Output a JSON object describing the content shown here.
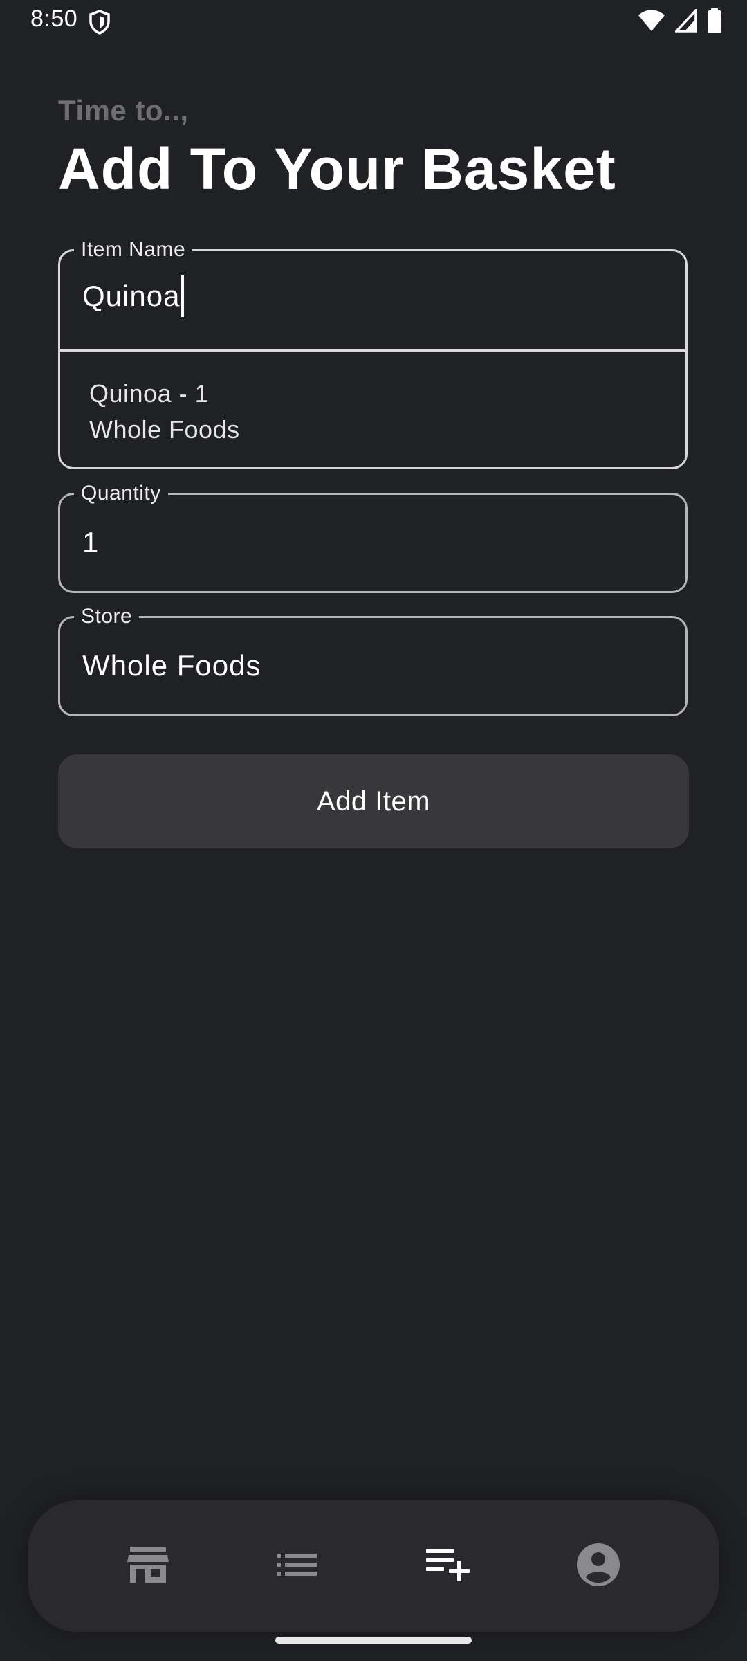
{
  "status_bar": {
    "time": "8:50",
    "left_icons": [
      "shield-icon"
    ],
    "right_icons": [
      "wifi-icon",
      "cell-signal-icon",
      "battery-icon"
    ]
  },
  "header": {
    "subtitle": "Time to..,",
    "title": "Add To Your Basket"
  },
  "form": {
    "item_name": {
      "label": "Item Name",
      "value": "Quinoa",
      "suggestion": {
        "line1": "Quinoa - 1",
        "line2": "Whole Foods"
      }
    },
    "quantity": {
      "label": "Quantity",
      "value": "1"
    },
    "store": {
      "label": "Store",
      "value": "Whole Foods"
    },
    "submit_label": "Add Item"
  },
  "bottom_nav": {
    "items": [
      {
        "icon": "storefront-icon",
        "active": false
      },
      {
        "icon": "list-icon",
        "active": false
      },
      {
        "icon": "playlist-add-icon",
        "active": true
      },
      {
        "icon": "account-circle-icon",
        "active": false
      }
    ]
  },
  "colors": {
    "background": "#202125",
    "muted_text": "#6f6f73",
    "button_bg": "#38383b",
    "nav_bg": "#2a2a2e",
    "inactive_icon": "#8a8a8e",
    "active_icon": "#ffffff"
  }
}
